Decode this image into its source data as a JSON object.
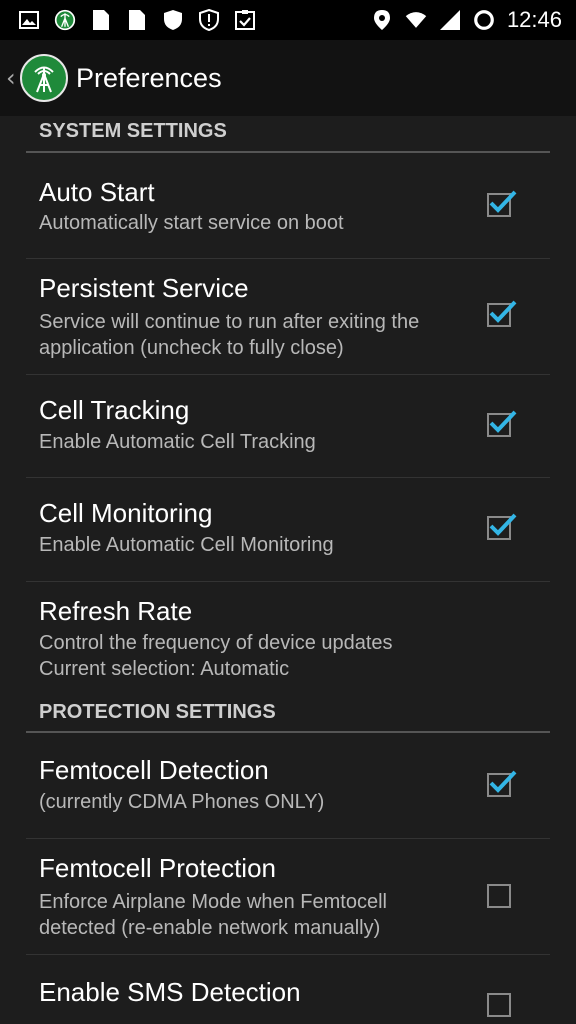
{
  "status_bar": {
    "time": "12:46",
    "left_icons": [
      "image-icon",
      "app-notification-icon",
      "file-icon",
      "file-icon",
      "shield-icon",
      "alert-shield-icon",
      "clipboard-check-icon"
    ],
    "right_icons": [
      "location-icon",
      "wifi-icon",
      "cell-signal-icon",
      "battery-ring-icon"
    ]
  },
  "action_bar": {
    "title": "Preferences",
    "accent": "#1f8a3a"
  },
  "sections": [
    {
      "header": "SYSTEM SETTINGS",
      "items": [
        {
          "title": "Auto Start",
          "summary": "Automatically start service on boot",
          "checked": true
        },
        {
          "title": "Persistent Service",
          "summary": "Service will continue to run after exiting the application (uncheck to fully close)",
          "checked": true
        },
        {
          "title": "Cell Tracking",
          "summary": "Enable Automatic Cell Tracking",
          "checked": true
        },
        {
          "title": "Cell Monitoring",
          "summary": "Enable Automatic Cell Monitoring",
          "checked": true
        },
        {
          "title": "Refresh Rate",
          "summary": "Control the frequency of device updates Current selection: Automatic"
        }
      ]
    },
    {
      "header": "PROTECTION SETTINGS",
      "items": [
        {
          "title": "Femtocell Detection",
          "summary": "(currently CDMA Phones ONLY)",
          "checked": true
        },
        {
          "title": "Femtocell Protection",
          "summary": "Enforce Airplane Mode when Femtocell detected (re-enable network manually)",
          "checked": false
        },
        {
          "title": "Enable SMS Detection",
          "summary": "",
          "checked": false
        }
      ]
    }
  ],
  "colors": {
    "check_mark": "#33b5e5",
    "background": "#1d1d1d",
    "header_text": "#cfcfcf"
  }
}
